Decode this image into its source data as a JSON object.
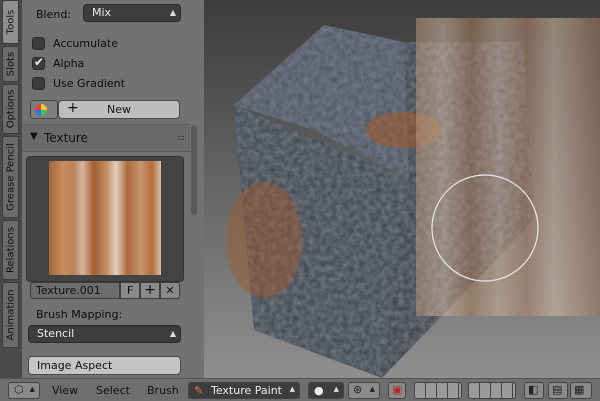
{
  "tabs": [
    "Tools",
    "Slots",
    "Options",
    "Grease Pencil",
    "Relations",
    "Animation"
  ],
  "tools": {
    "blend_label": "Blend:",
    "blend_value": "Mix",
    "checkboxes": [
      {
        "label": "Accumulate",
        "checked": false
      },
      {
        "label": "Alpha",
        "checked": true
      },
      {
        "label": "Use Gradient",
        "checked": false
      }
    ],
    "new_button": "New"
  },
  "texture": {
    "header": "Texture",
    "collapse_glyph": "▼",
    "name": "Texture.001",
    "fake_user": "F",
    "brush_mapping_label": "Brush Mapping:",
    "brush_mapping_value": "Stencil",
    "image_aspect_button": "Image Aspect"
  },
  "header": {
    "view": "View",
    "select": "Select",
    "brush": "Brush",
    "mode": "Texture Paint"
  },
  "colors": {
    "rust": "#a45a2c",
    "cube_dark": "#3d434d",
    "stencil_tint": "#c89a78"
  },
  "icons": [
    "view3d-editor-icon",
    "color-wheel-icon",
    "plus-icon",
    "close-icon",
    "brush-mode-icon",
    "sphere-shading-icon",
    "pivot-icon",
    "snap-icon",
    "render-icon",
    "camera-icon",
    "film-icon"
  ]
}
